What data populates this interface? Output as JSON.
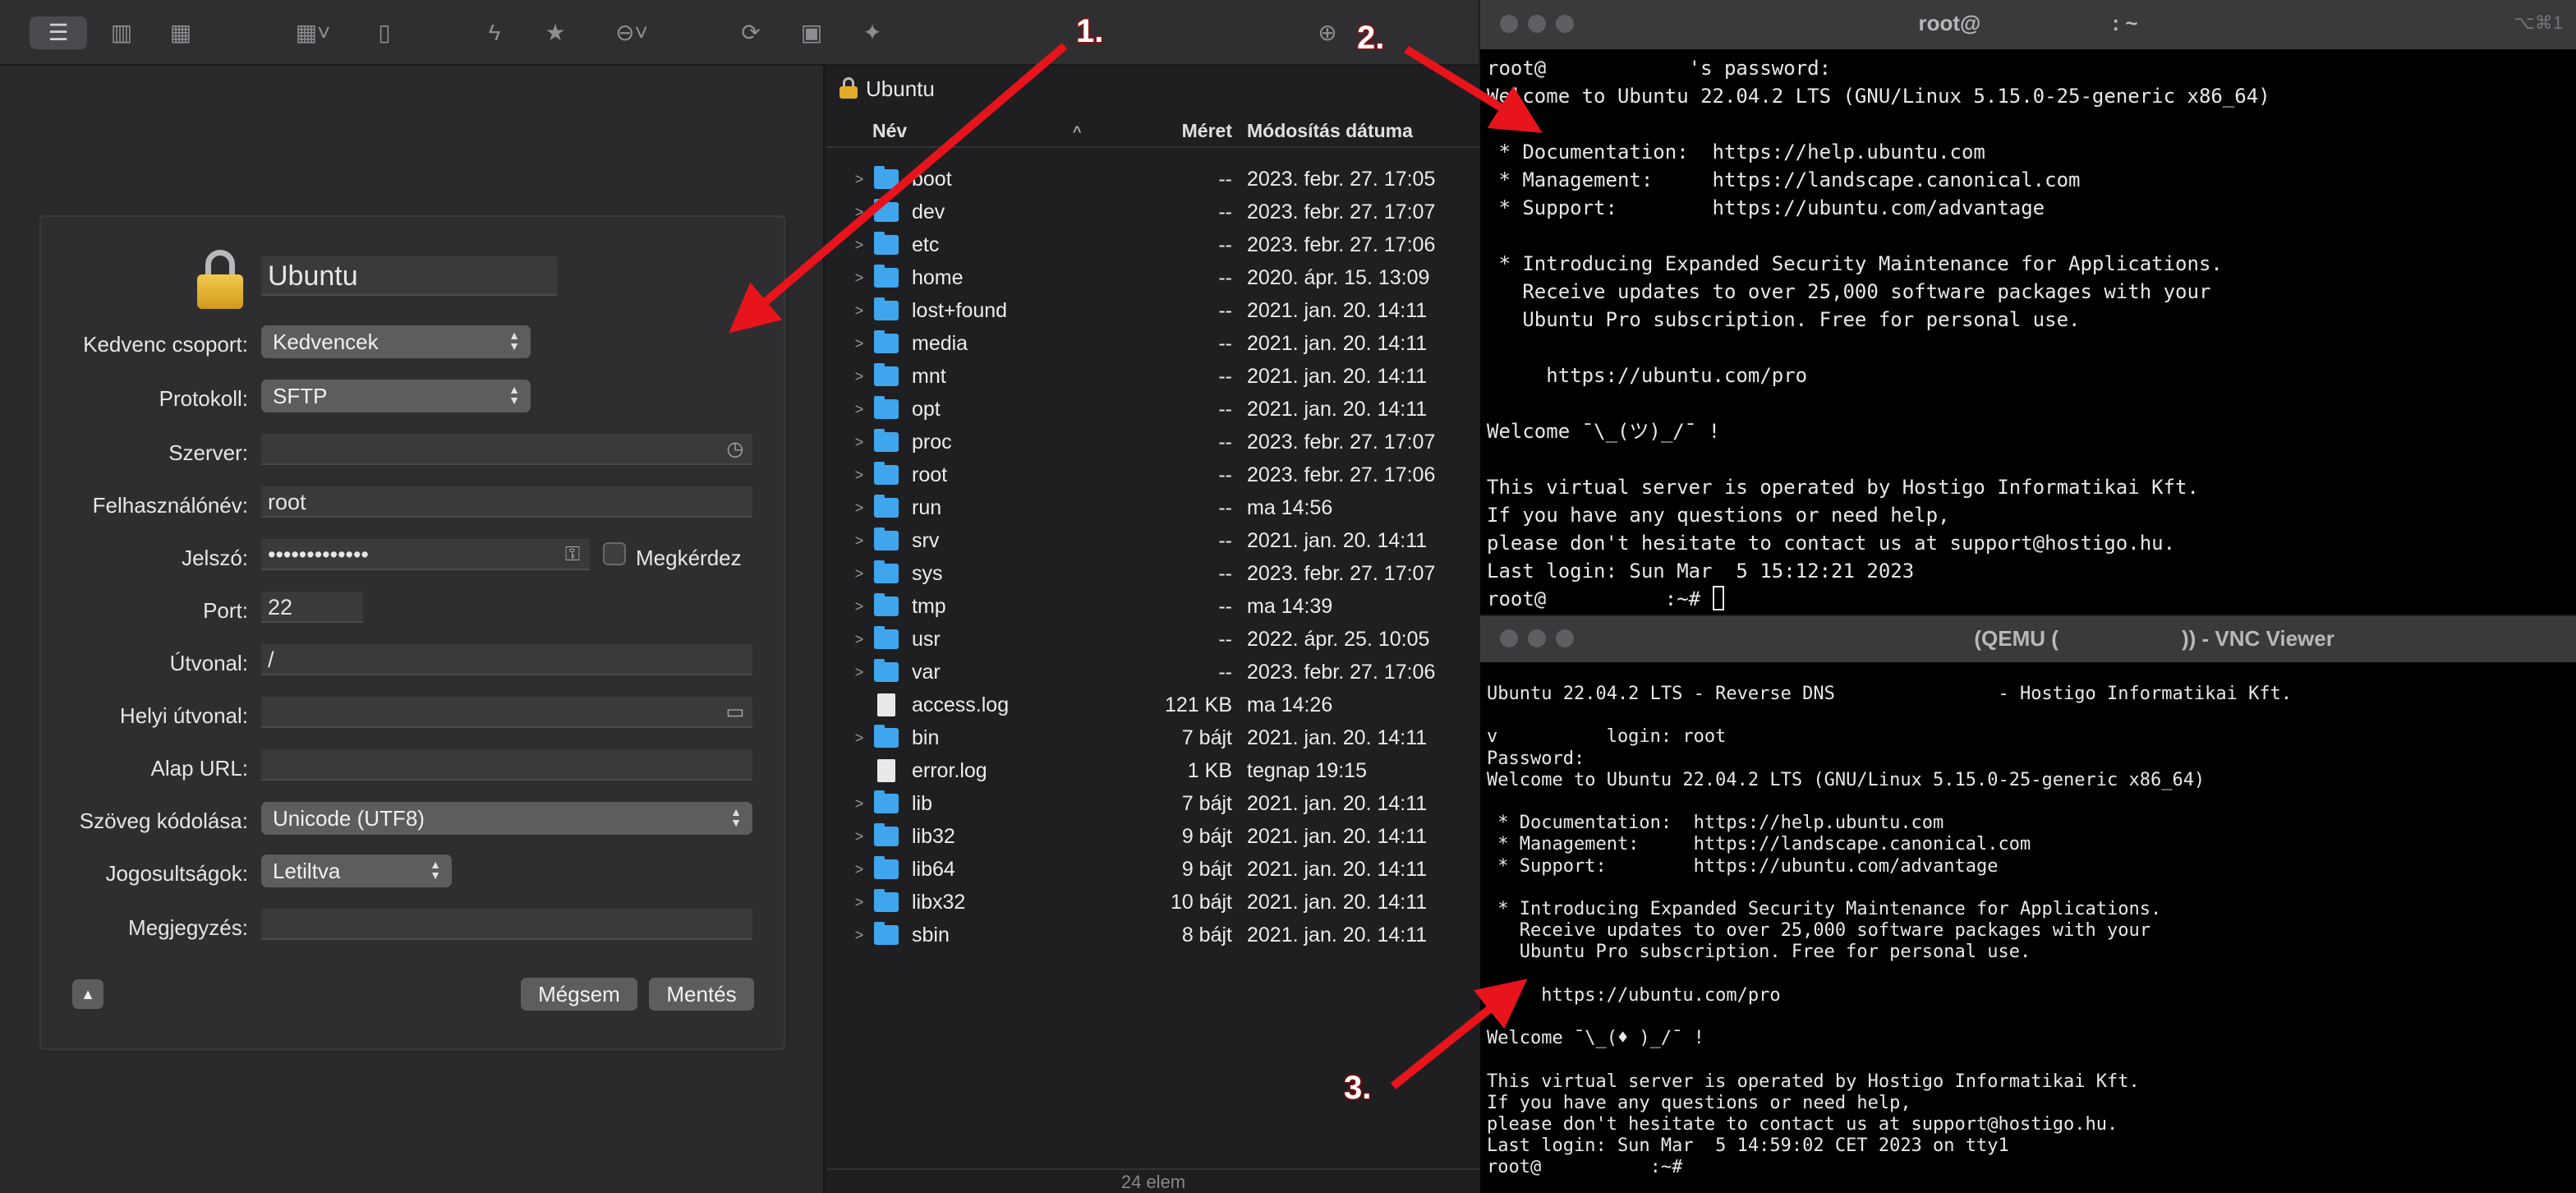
{
  "toolbar": {
    "icons": [
      "list-view-icon",
      "column-view-icon",
      "grid-view-icon",
      "arrange-icon",
      "document-icon",
      "action-icon",
      "bookmark-star-icon",
      "more-icon",
      "refresh-icon",
      "terminal-icon",
      "sparkle-icon",
      "download-icon"
    ]
  },
  "form": {
    "bookmark_title": "Ubuntu",
    "labels": {
      "group": "Kedvenc csoport:",
      "protocol": "Protokoll:",
      "server": "Szerver:",
      "username": "Felhasználónév:",
      "password": "Jelszó:",
      "port": "Port:",
      "path": "Útvonal:",
      "local_path": "Helyi útvonal:",
      "base_url": "Alap URL:",
      "encoding": "Szöveg kódolása:",
      "permissions": "Jogosultságok:",
      "notes": "Megjegyzés:"
    },
    "values": {
      "group": "Kedvencek",
      "protocol": "SFTP",
      "server": "",
      "username": "root",
      "password": "•••••••••••••",
      "port": "22",
      "path": "/",
      "local_path": "",
      "base_url": "",
      "encoding": "Unicode (UTF8)",
      "permissions": "Letiltva",
      "notes": ""
    },
    "ask_label": "Megkérdez",
    "cancel_label": "Mégsem",
    "save_label": "Mentés"
  },
  "browser": {
    "path": "Ubuntu",
    "columns": {
      "name": "Név",
      "size": "Méret",
      "date": "Módosítás dátuma"
    },
    "rows": [
      {
        "name": "boot",
        "size": "--",
        "date": "2023. febr. 27. 17:05",
        "type": "folder"
      },
      {
        "name": "dev",
        "size": "--",
        "date": "2023. febr. 27. 17:07",
        "type": "folder"
      },
      {
        "name": "etc",
        "size": "--",
        "date": "2023. febr. 27. 17:06",
        "type": "folder"
      },
      {
        "name": "home",
        "size": "--",
        "date": "2020. ápr. 15. 13:09",
        "type": "folder"
      },
      {
        "name": "lost+found",
        "size": "--",
        "date": "2021. jan. 20. 14:11",
        "type": "folder"
      },
      {
        "name": "media",
        "size": "--",
        "date": "2021. jan. 20. 14:11",
        "type": "folder"
      },
      {
        "name": "mnt",
        "size": "--",
        "date": "2021. jan. 20. 14:11",
        "type": "folder"
      },
      {
        "name": "opt",
        "size": "--",
        "date": "2021. jan. 20. 14:11",
        "type": "folder"
      },
      {
        "name": "proc",
        "size": "--",
        "date": "2023. febr. 27. 17:07",
        "type": "folder"
      },
      {
        "name": "root",
        "size": "--",
        "date": "2023. febr. 27. 17:06",
        "type": "folder"
      },
      {
        "name": "run",
        "size": "--",
        "date": "ma 14:56",
        "type": "folder"
      },
      {
        "name": "srv",
        "size": "--",
        "date": "2021. jan. 20. 14:11",
        "type": "folder"
      },
      {
        "name": "sys",
        "size": "--",
        "date": "2023. febr. 27. 17:07",
        "type": "folder"
      },
      {
        "name": "tmp",
        "size": "--",
        "date": "ma 14:39",
        "type": "folder"
      },
      {
        "name": "usr",
        "size": "--",
        "date": "2022. ápr. 25. 10:05",
        "type": "folder"
      },
      {
        "name": "var",
        "size": "--",
        "date": "2023. febr. 27. 17:06",
        "type": "folder"
      },
      {
        "name": "access.log",
        "size": "121 KB",
        "date": "ma 14:26",
        "type": "file"
      },
      {
        "name": "bin",
        "size": "7 bájt",
        "date": "2021. jan. 20. 14:11",
        "type": "folder"
      },
      {
        "name": "error.log",
        "size": "1 KB",
        "date": "tegnap 19:15",
        "type": "file"
      },
      {
        "name": "lib",
        "size": "7 bájt",
        "date": "2021. jan. 20. 14:11",
        "type": "folder"
      },
      {
        "name": "lib32",
        "size": "9 bájt",
        "date": "2021. jan. 20. 14:11",
        "type": "folder"
      },
      {
        "name": "lib64",
        "size": "9 bájt",
        "date": "2021. jan. 20. 14:11",
        "type": "folder"
      },
      {
        "name": "libx32",
        "size": "10 bájt",
        "date": "2021. jan. 20. 14:11",
        "type": "folder"
      },
      {
        "name": "sbin",
        "size": "8 bájt",
        "date": "2021. jan. 20. 14:11",
        "type": "folder"
      }
    ],
    "status": "24 elem"
  },
  "ssh_terminal": {
    "title_prefix": "root@",
    "title_suffix": ": ~",
    "shortcut": "⌥⌘1",
    "lines": [
      "root@            's password:",
      "Welcome to Ubuntu 22.04.2 LTS (GNU/Linux 5.15.0-25-generic x86_64)",
      "",
      " * Documentation:  https://help.ubuntu.com",
      " * Management:     https://landscape.canonical.com",
      " * Support:        https://ubuntu.com/advantage",
      "",
      " * Introducing Expanded Security Maintenance for Applications.",
      "   Receive updates to over 25,000 software packages with your",
      "   Ubuntu Pro subscription. Free for personal use.",
      "",
      "     https://ubuntu.com/pro",
      "",
      "Welcome ¯\\_(ツ)_/¯ !",
      "",
      "This virtual server is operated by Hostigo Informatikai Kft.",
      "If you have any questions or need help,",
      "please don't hesitate to contact us at support@hostigo.hu.",
      "Last login: Sun Mar  5 15:12:21 2023"
    ],
    "prompt": "root@          :~# "
  },
  "vnc_terminal": {
    "title_mid": "(QEMU (",
    "title_end": ")) - VNC Viewer",
    "lines": [
      "Ubuntu 22.04.2 LTS - Reverse DNS               - Hostigo Informatikai Kft.",
      "",
      "v          login: root",
      "Password:",
      "Welcome to Ubuntu 22.04.2 LTS (GNU/Linux 5.15.0-25-generic x86_64)",
      "",
      " * Documentation:  https://help.ubuntu.com",
      " * Management:     https://landscape.canonical.com",
      " * Support:        https://ubuntu.com/advantage",
      "",
      " * Introducing Expanded Security Maintenance for Applications.",
      "   Receive updates to over 25,000 software packages with your",
      "   Ubuntu Pro subscription. Free for personal use.",
      "",
      "     https://ubuntu.com/pro",
      "",
      "Welcome ¯\\_(♦ )_/¯ !",
      "",
      "This virtual server is operated by Hostigo Informatikai Kft.",
      "If you have any questions or need help,",
      "please don't hesitate to contact us at support@hostigo.hu.",
      "Last login: Sun Mar  5 14:59:02 CET 2023 on tty1",
      "root@          :~#"
    ]
  },
  "annotations": [
    "1.",
    "2.",
    "3."
  ],
  "colors": {
    "arrow": "#e8141c",
    "folder": "#3fa6ee",
    "lock": "#e1aa2a"
  }
}
